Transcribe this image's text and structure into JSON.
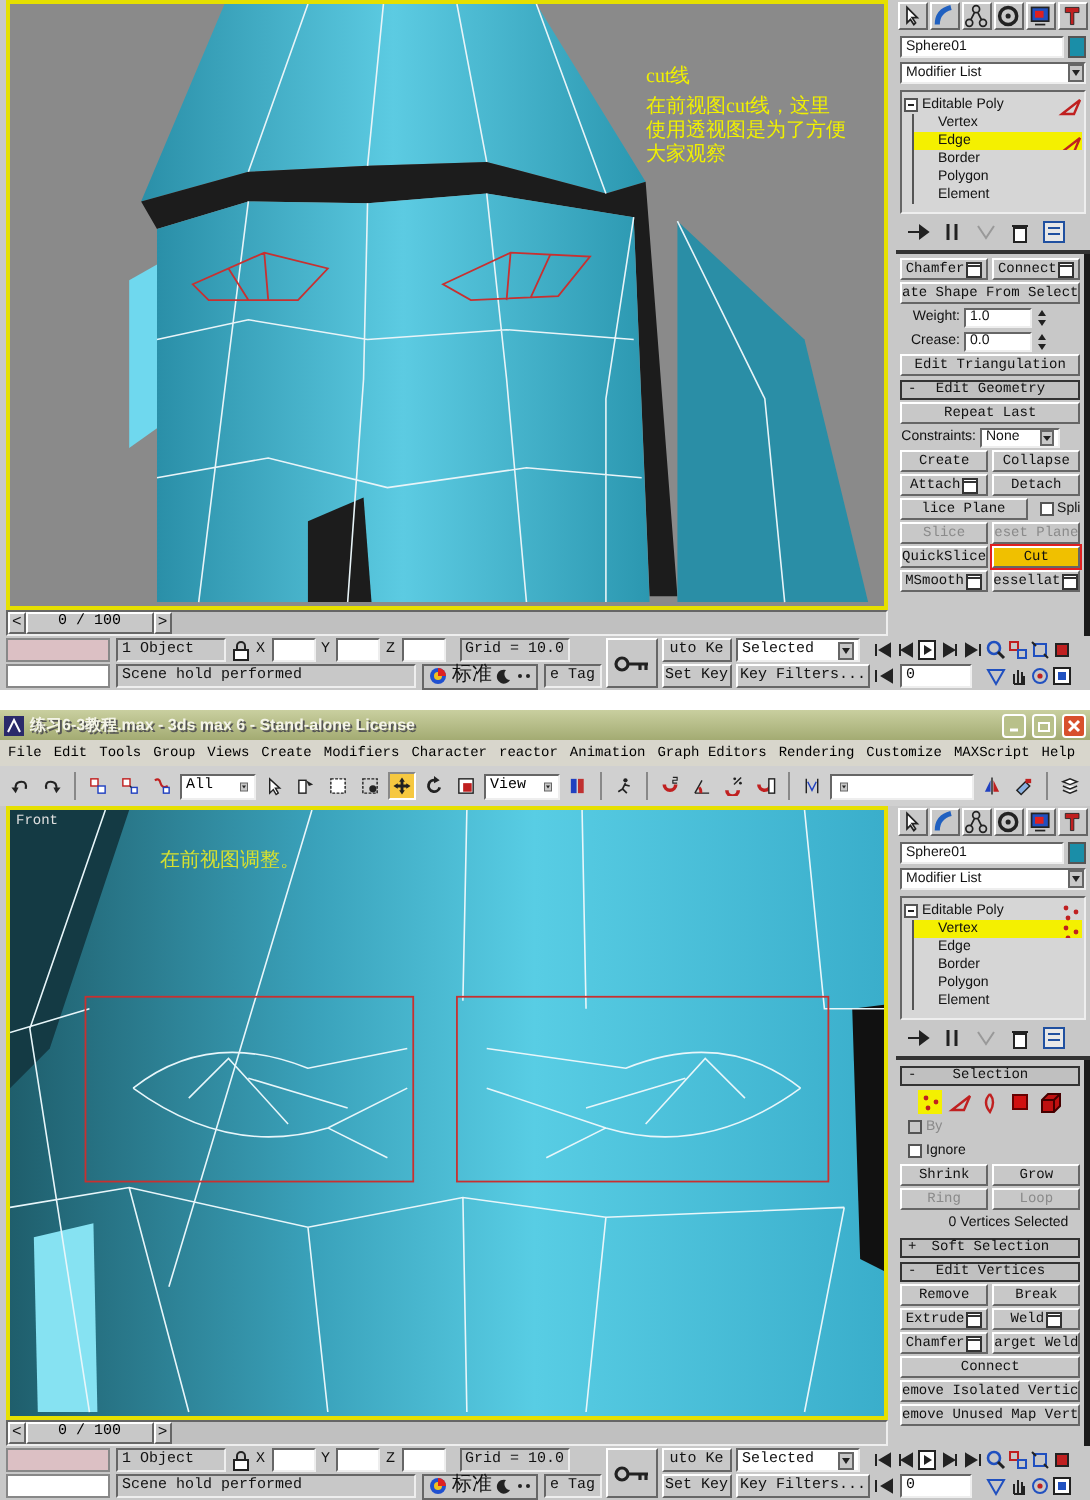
{
  "screenshots": [
    {
      "viewport": {
        "kind": "perspective",
        "notes": [
          {
            "text": "cut线"
          },
          {
            "text": "在前视图cut线，这里使用透视图是为了方便大家观察"
          }
        ]
      },
      "command_panel": {
        "object_name": "Sphere01",
        "modifier_list": "Modifier List",
        "modifier_stack": [
          {
            "label": "Editable Poly",
            "expanded": true,
            "selected": false,
            "children": [
              {
                "label": "Vertex",
                "selected": false
              },
              {
                "label": "Edge",
                "kind": "edge",
                "selected": true
              },
              {
                "label": "Border",
                "selected": false
              },
              {
                "label": "Polygon",
                "selected": false
              },
              {
                "label": "Element",
                "selected": false
              }
            ]
          }
        ],
        "rows": [
          [
            {
              "kind": "button",
              "label": "Chamfer",
              "settings": true,
              "disabled": false,
              "active": false,
              "circled": false
            },
            {
              "kind": "button",
              "label": "Connect",
              "settings": true,
              "disabled": false,
              "active": false,
              "circled": false
            }
          ],
          [
            {
              "kind": "button",
              "label": "ate Shape From Select",
              "settings": false,
              "disabled": false,
              "active": false,
              "circled": false
            }
          ],
          [
            {
              "kind": "spinner",
              "label": "Weight:",
              "value": "1.0"
            }
          ],
          [
            {
              "kind": "spinner",
              "label": "Crease:",
              "value": "0.0"
            }
          ],
          [
            {
              "kind": "button",
              "label": "Edit Triangulation",
              "settings": false,
              "disabled": false,
              "active": false,
              "circled": false
            }
          ],
          [
            {
              "kind": "header",
              "sign": "-",
              "label": "Edit Geometry"
            }
          ],
          [
            {
              "kind": "button",
              "label": "Repeat Last",
              "settings": false,
              "disabled": false,
              "active": false,
              "circled": false
            }
          ],
          [
            {
              "kind": "dropdown",
              "label": "Constraints:",
              "value": "None"
            }
          ],
          [
            {
              "kind": "button",
              "label": "Create",
              "settings": false,
              "disabled": false,
              "active": false,
              "circled": false
            },
            {
              "kind": "button",
              "label": "Collapse",
              "settings": false,
              "disabled": false,
              "active": false,
              "circled": false
            }
          ],
          [
            {
              "kind": "button",
              "label": "Attach",
              "settings": true,
              "disabled": false,
              "active": false,
              "circled": false
            },
            {
              "kind": "button",
              "label": "Detach",
              "settings": false,
              "disabled": false,
              "active": false,
              "circled": false
            }
          ],
          [
            {
              "kind": "button",
              "label": "lice Plane",
              "settings": false,
              "disabled": false,
              "active": false,
              "circled": false
            },
            {
              "kind": "check",
              "label": "Spli",
              "checked": false,
              "disabled": false
            }
          ],
          [
            {
              "kind": "button",
              "label": "Slice",
              "settings": false,
              "disabled": true,
              "active": false,
              "circled": false
            },
            {
              "kind": "button",
              "label": "eset Plane",
              "settings": false,
              "disabled": true,
              "active": false,
              "circled": false
            }
          ],
          [
            {
              "kind": "button",
              "label": "QuickSlice",
              "settings": false,
              "disabled": false,
              "active": false,
              "circled": false
            },
            {
              "kind": "button",
              "label": "Cut",
              "settings": false,
              "disabled": false,
              "active": true,
              "circled": true
            }
          ],
          [
            {
              "kind": "button",
              "label": "MSmooth",
              "settings": true,
              "disabled": false,
              "active": false,
              "circled": false
            },
            {
              "kind": "button",
              "label": "essellat",
              "settings": true,
              "disabled": false,
              "active": false,
              "circled": false
            }
          ]
        ]
      },
      "timeline": {
        "prev": "<",
        "thumb": "0 / 100",
        "next": ">",
        "level": 0
      },
      "status_bar": {
        "selection": "1 Object",
        "prompt": "Scene hold performed",
        "coords": [
          {
            "label": "X"
          },
          {
            "label": "Y"
          },
          {
            "label": "Z"
          }
        ],
        "grid": "Grid = 10.0",
        "ime": "标准",
        "time_tag": "e Tag",
        "auto_key": "uto Ke",
        "set_key": "Set Key",
        "key_mode": "Selected",
        "key_filters": "Key Filters...",
        "frame": "0"
      }
    },
    {
      "window": {
        "title": "练习6-3教程.max - 3ds max 6 - Stand-alone License"
      },
      "menu": [
        "File",
        "Edit",
        "Tools",
        "Group",
        "Views",
        "Create",
        "Modifiers",
        "Character",
        "reactor",
        "Animation",
        "Graph Editors",
        "Rendering",
        "Customize",
        "MAXScript",
        "Help"
      ],
      "toolbar": [
        {
          "kind": "undo",
          "selected": false
        },
        {
          "kind": "redo",
          "selected": false
        },
        {
          "kind": "separator"
        },
        {
          "kind": "link",
          "selected": false
        },
        {
          "kind": "unlink",
          "selected": false
        },
        {
          "kind": "bind",
          "selected": false
        },
        {
          "kind": "dropdown",
          "value": "All"
        },
        {
          "kind": "select",
          "selected": false
        },
        {
          "kind": "select_by_name",
          "selected": false
        },
        {
          "kind": "region",
          "selected": false
        },
        {
          "kind": "crossing",
          "selected": false
        },
        {
          "kind": "move",
          "selected": true
        },
        {
          "kind": "rotate",
          "selected": false
        },
        {
          "kind": "scale",
          "selected": false
        },
        {
          "kind": "dropdown",
          "value": "View"
        },
        {
          "kind": "pivot",
          "selected": false
        },
        {
          "kind": "separator"
        },
        {
          "kind": "manipulate",
          "selected": false
        },
        {
          "kind": "separator"
        },
        {
          "kind": "snap",
          "selected": false
        },
        {
          "kind": "angle_snap",
          "selected": false
        },
        {
          "kind": "percent_snap",
          "selected": false
        },
        {
          "kind": "spinner_snap",
          "selected": false
        },
        {
          "kind": "separator"
        },
        {
          "kind": "named_selection",
          "selected": false
        },
        {
          "kind": "dropdown"
        },
        {
          "kind": "mirror",
          "selected": false
        },
        {
          "kind": "align",
          "selected": false
        },
        {
          "kind": "separator"
        },
        {
          "kind": "layers",
          "selected": false
        }
      ],
      "viewport": {
        "kind": "front",
        "label": "Front",
        "notes": [
          {
            "text": "在前视图调整。"
          }
        ]
      },
      "command_panel": {
        "object_name": "Sphere01",
        "modifier_list": "Modifier List",
        "modifier_stack": [
          {
            "label": "Editable Poly",
            "expanded": true,
            "selected": false,
            "children": [
              {
                "label": "Vertex",
                "kind": "vertex",
                "selected": true
              },
              {
                "label": "Edge",
                "selected": false
              },
              {
                "label": "Border",
                "selected": false
              },
              {
                "label": "Polygon",
                "selected": false
              },
              {
                "label": "Element",
                "selected": false
              }
            ]
          }
        ],
        "rows": [
          [
            {
              "kind": "header",
              "sign": "-",
              "label": "Selection"
            }
          ],
          [
            {
              "kind": "subobjects",
              "items": [
                {
                  "kind": "vertex",
                  "selected": true
                },
                {
                  "kind": "edge",
                  "selected": false
                },
                {
                  "kind": "border",
                  "selected": false
                },
                {
                  "kind": "polygon",
                  "selected": false
                },
                {
                  "kind": "element",
                  "selected": false
                }
              ]
            }
          ],
          [
            {
              "kind": "check",
              "label": "By",
              "checked": false,
              "disabled": true
            }
          ],
          [
            {
              "kind": "check",
              "label": "Ignore",
              "checked": false,
              "disabled": false
            }
          ],
          [
            {
              "kind": "button",
              "label": "Shrink",
              "settings": false,
              "disabled": false,
              "active": false,
              "circled": false
            },
            {
              "kind": "button",
              "label": "Grow",
              "settings": false,
              "disabled": false,
              "active": false,
              "circled": false
            }
          ],
          [
            {
              "kind": "button",
              "label": "Ring",
              "settings": false,
              "disabled": true,
              "active": false,
              "circled": false
            },
            {
              "kind": "button",
              "label": "Loop",
              "settings": false,
              "disabled": true,
              "active": false,
              "circled": false
            }
          ],
          [
            {
              "kind": "text",
              "label": "0 Vertices Selected"
            }
          ],
          [
            {
              "kind": "header",
              "sign": "+",
              "label": "Soft Selection"
            }
          ],
          [
            {
              "kind": "header",
              "sign": "-",
              "label": "Edit Vertices"
            }
          ],
          [
            {
              "kind": "button",
              "label": "Remove",
              "settings": false,
              "disabled": false,
              "active": false,
              "circled": false
            },
            {
              "kind": "button",
              "label": "Break",
              "settings": false,
              "disabled": false,
              "active": false,
              "circled": false
            }
          ],
          [
            {
              "kind": "button",
              "label": "Extrude",
              "settings": true,
              "disabled": false,
              "active": false,
              "circled": false
            },
            {
              "kind": "button",
              "label": "Weld",
              "settings": true,
              "disabled": false,
              "active": false,
              "circled": false
            }
          ],
          [
            {
              "kind": "button",
              "label": "Chamfer",
              "settings": true,
              "disabled": false,
              "active": false,
              "circled": false
            },
            {
              "kind": "button",
              "label": "arget Weld",
              "settings": false,
              "disabled": false,
              "active": false,
              "circled": false
            }
          ],
          [
            {
              "kind": "button",
              "label": "Connect",
              "settings": false,
              "disabled": false,
              "active": false,
              "circled": false
            }
          ],
          [
            {
              "kind": "button",
              "label": "emove Isolated Vertic",
              "settings": false,
              "disabled": false,
              "active": false,
              "circled": false
            }
          ],
          [
            {
              "kind": "button",
              "label": "emove Unused Map Vert",
              "settings": false,
              "disabled": false,
              "active": false,
              "circled": false
            }
          ]
        ]
      },
      "timeline": {
        "prev": "<",
        "thumb": "0 / 100",
        "next": ">",
        "level": 0
      },
      "status_bar": {
        "selection": "1 Object",
        "prompt": "Scene hold performed",
        "coords": [
          {
            "label": "X"
          },
          {
            "label": "Y"
          },
          {
            "label": "Z"
          }
        ],
        "grid": "Grid = 10.0",
        "ime": "标准",
        "time_tag": "e Tag",
        "auto_key": "uto Ke",
        "set_key": "Set Key",
        "key_mode": "Selected",
        "key_filters": "Key Filters...",
        "frame": "0"
      }
    }
  ]
}
